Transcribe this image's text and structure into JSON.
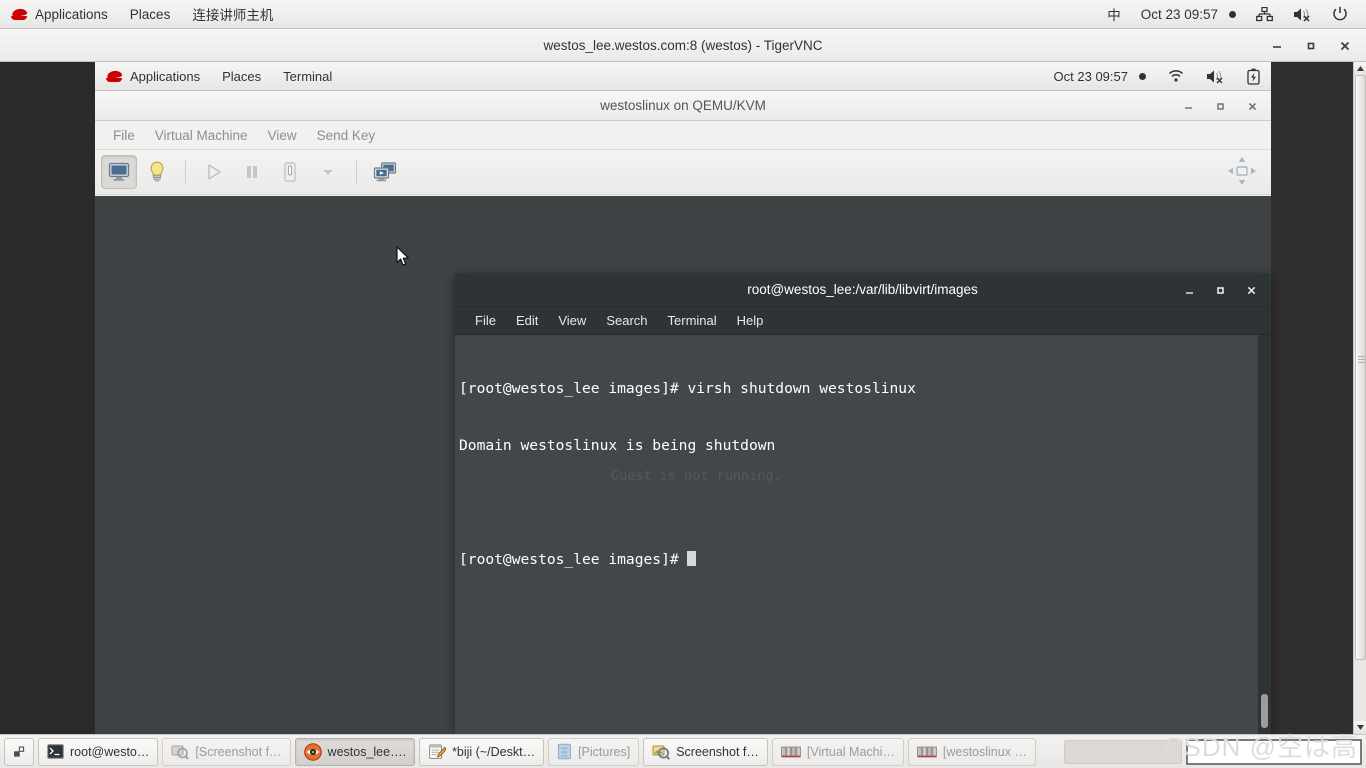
{
  "host_panel": {
    "activities_label": "Applications",
    "places_label": "Places",
    "extra_label": "连接讲师主机",
    "ime_label": "中",
    "clock": "Oct 23  09:57",
    "icons": [
      "network-wired-icon",
      "volume-muted-icon",
      "power-icon"
    ]
  },
  "vnc_window": {
    "title": "westos_lee.westos.com:8 (westos) - TigerVNC",
    "minimize_label": "—",
    "maximize_label": "▫",
    "close_label": "✕"
  },
  "guest_panel": {
    "applications_label": "Applications",
    "places_label": "Places",
    "terminal_label": "Terminal",
    "clock": "Oct 23  09:57",
    "icons": [
      "wifi-icon",
      "volume-muted-icon",
      "battery-icon"
    ]
  },
  "virt_manager": {
    "title": "westoslinux on QEMU/KVM",
    "minimize_label": "—",
    "maximize_label": "▫",
    "close_label": "✕",
    "menus": [
      "File",
      "Virtual Machine",
      "View",
      "Send Key"
    ],
    "toolbar": [
      {
        "name": "console-view-button",
        "state": "pressed"
      },
      {
        "name": "show-details-button",
        "state": "normal"
      },
      {
        "name": "run-button",
        "state": "disabled"
      },
      {
        "name": "pause-button",
        "state": "disabled"
      },
      {
        "name": "shutdown-button",
        "state": "disabled"
      },
      {
        "name": "shutdown-dropdown-button",
        "state": "disabled"
      },
      {
        "name": "snapshots-button",
        "state": "normal"
      },
      {
        "name": "fullscreen-button",
        "state": "normal"
      }
    ],
    "console_message": "Guest is not running."
  },
  "terminal": {
    "title": "root@westos_lee:/var/lib/libvirt/images",
    "minimize_label": "—",
    "maximize_label": "▫",
    "close_label": "✕",
    "menus": [
      "File",
      "Edit",
      "View",
      "Search",
      "Terminal",
      "Help"
    ],
    "lines": [
      "[root@westos_lee images]# virsh shutdown westoslinux",
      "Domain westoslinux is being shutdown",
      "",
      "[root@westos_lee images]# "
    ],
    "line0": "[root@westos_lee images]# virsh shutdown westoslinux",
    "line1": "Domain westoslinux is being shutdown",
    "line2": "",
    "line3": "[root@westos_lee images]# "
  },
  "taskbar": {
    "show_desktop_label": "",
    "items": [
      {
        "label": "root@westo…",
        "icon": "terminal-icon",
        "state": "normal"
      },
      {
        "label": "[Screenshot f…",
        "icon": "screenshot-icon",
        "state": "inactive"
      },
      {
        "label": "westos_lee….",
        "icon": "vnc-icon",
        "state": "active"
      },
      {
        "label": "*biji (~/Deskt…",
        "icon": "notepad-icon",
        "state": "normal"
      },
      {
        "label": "[Pictures]",
        "icon": "folder-icon",
        "state": "inactive"
      },
      {
        "label": "Screenshot f…",
        "icon": "screenshot-icon",
        "state": "normal"
      },
      {
        "label": "[Virtual Machi…",
        "icon": "virt-manager-icon",
        "state": "inactive"
      },
      {
        "label": "[westoslinux …",
        "icon": "virt-manager-icon",
        "state": "inactive"
      }
    ]
  },
  "watermark": {
    "text": "CSDN @空は高"
  },
  "colors": {
    "panel_bg": "#f0eeec",
    "terminal_bg": "#434749",
    "terminal_titlebar": "#2e3436",
    "console_bg": "#3f4345",
    "accent_red": "#cc0000"
  }
}
